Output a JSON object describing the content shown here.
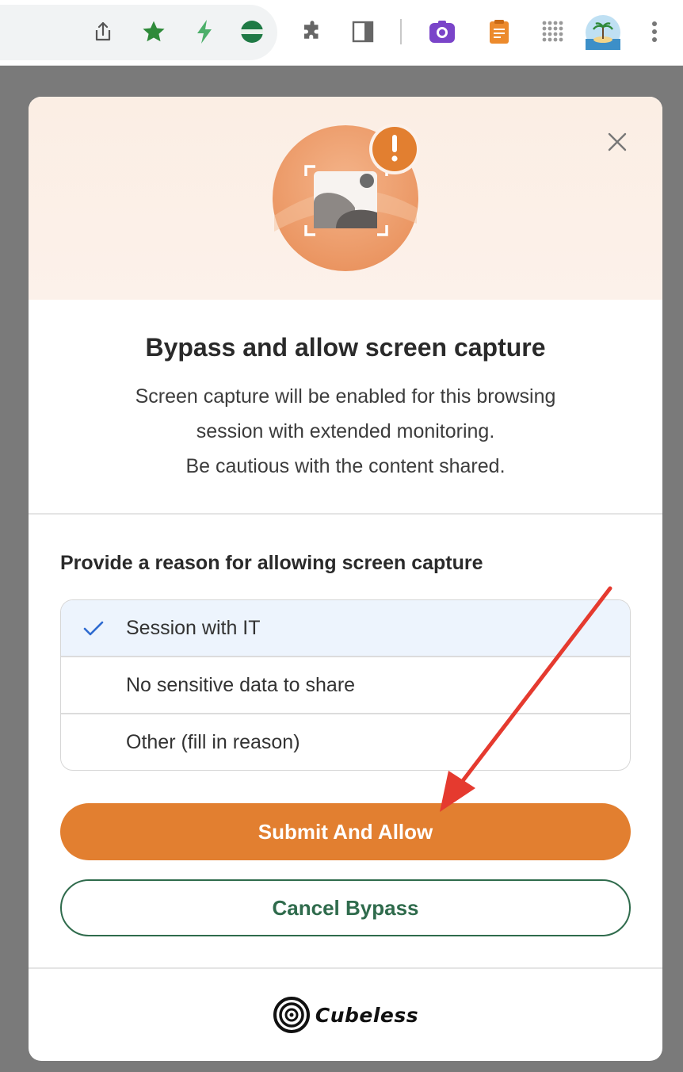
{
  "toolbar": {
    "icons": [
      "share-icon",
      "bookmark-star-icon",
      "lightning-extension-icon",
      "green-circle-extension-icon",
      "puzzle-extensions-icon",
      "side-panel-icon",
      "camera-extension-icon",
      "notes-extension-icon",
      "apps-grid-icon",
      "profile-avatar",
      "more-menu-icon"
    ]
  },
  "dialog": {
    "title": "Bypass and allow screen capture",
    "description": [
      "Screen capture will be enabled for this browsing",
      "session with extended monitoring.",
      "Be cautious with the content shared."
    ],
    "reason_heading": "Provide a reason for allowing screen capture",
    "options": [
      {
        "label": "Session with IT",
        "selected": true
      },
      {
        "label": "No sensitive data to share",
        "selected": false
      },
      {
        "label": "Other (fill in reason)",
        "selected": false
      }
    ],
    "submit_label": "Submit And Allow",
    "cancel_label": "Cancel Bypass",
    "brand": "Cubeless"
  },
  "colors": {
    "accent": "#e27f30",
    "secondary": "#2f6b4c",
    "selected_bg": "#edf4fd",
    "check": "#2f6bd0",
    "annotation_arrow": "#e53a2f"
  }
}
